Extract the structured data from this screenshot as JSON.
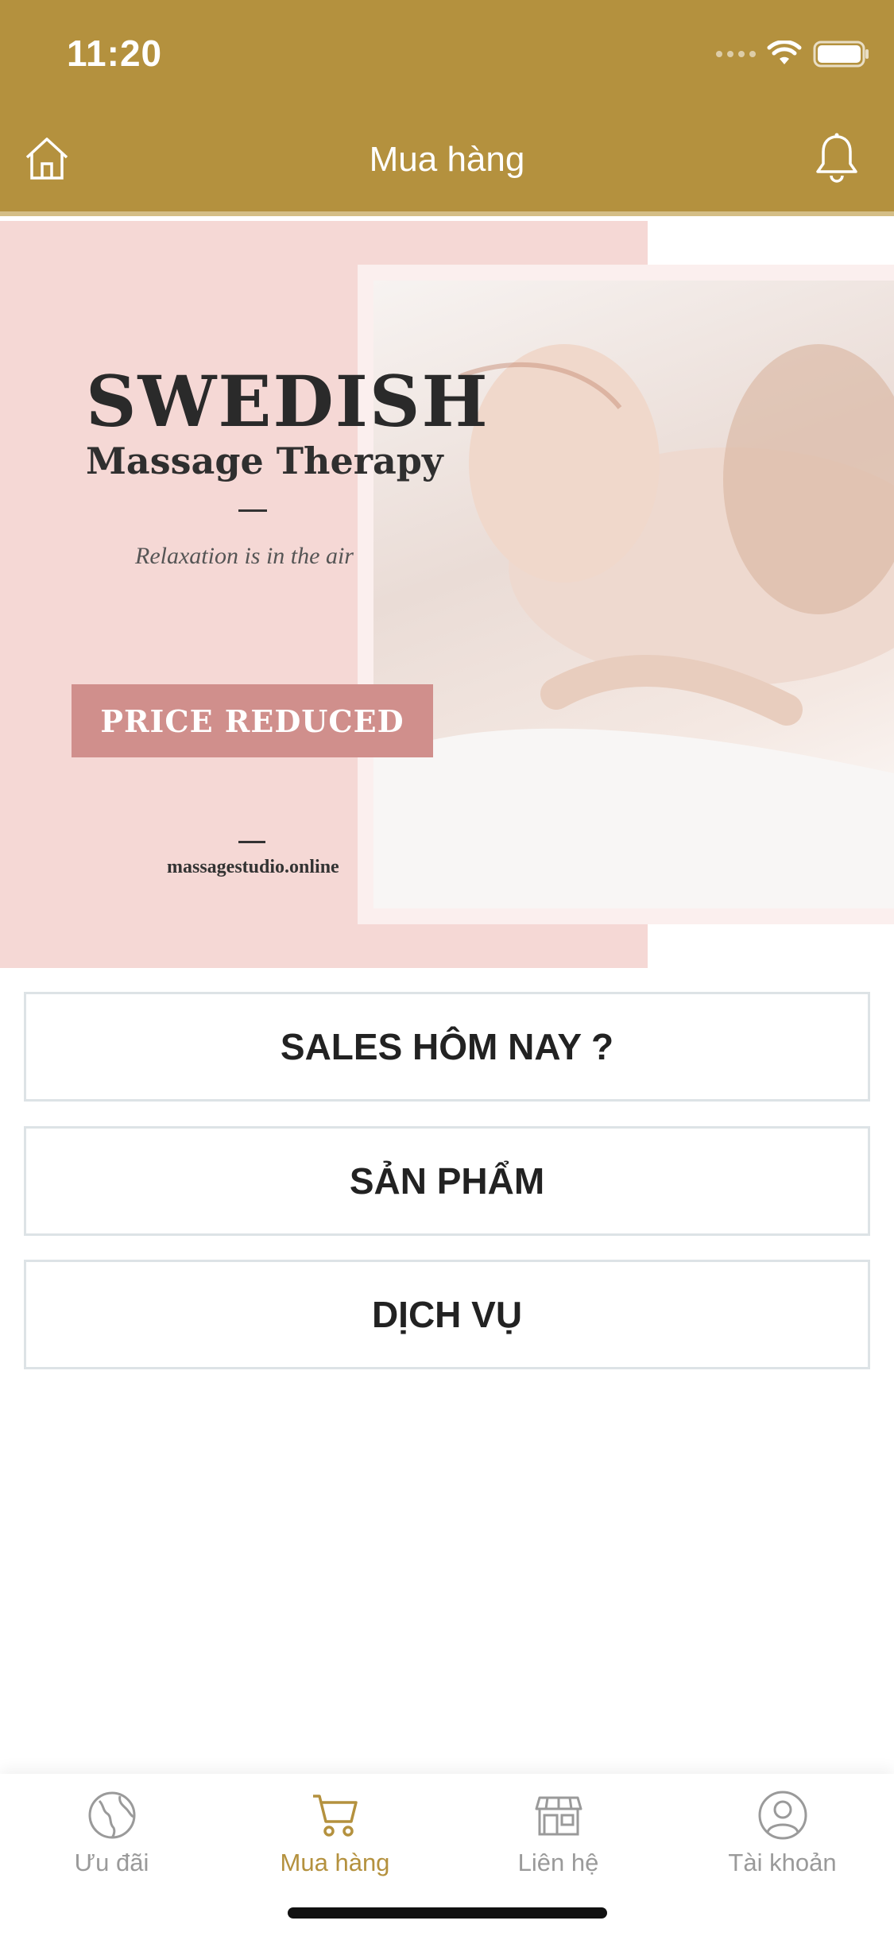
{
  "status_bar": {
    "time": "11:20"
  },
  "nav": {
    "title": "Mua hàng",
    "home_icon": "home-icon",
    "bell_icon": "bell-icon"
  },
  "banner": {
    "headline": "SWEDISH",
    "subhead": "Massage Therapy",
    "tagline": "Relaxation is in the air",
    "price_label": "PRICE REDUCED",
    "website": "massagestudio.online"
  },
  "menu": {
    "items": [
      {
        "label": "SALES HÔM NAY ?"
      },
      {
        "label": "SẢN PHẨM"
      },
      {
        "label": "DỊCH VỤ"
      }
    ]
  },
  "tabbar": {
    "accent_color": "#B4913E",
    "inactive_color": "#9A9A9A",
    "items": [
      {
        "label": "Ưu đãi",
        "icon": "globe-icon",
        "active": false
      },
      {
        "label": "Mua hàng",
        "icon": "cart-icon",
        "active": true
      },
      {
        "label": "Liên hệ",
        "icon": "store-icon",
        "active": false
      },
      {
        "label": "Tài khoản",
        "icon": "user-icon",
        "active": false
      }
    ]
  },
  "colors": {
    "header_bg": "#B4913E",
    "banner_pink": "#F5D8D5",
    "price_box": "#D08F8C"
  }
}
